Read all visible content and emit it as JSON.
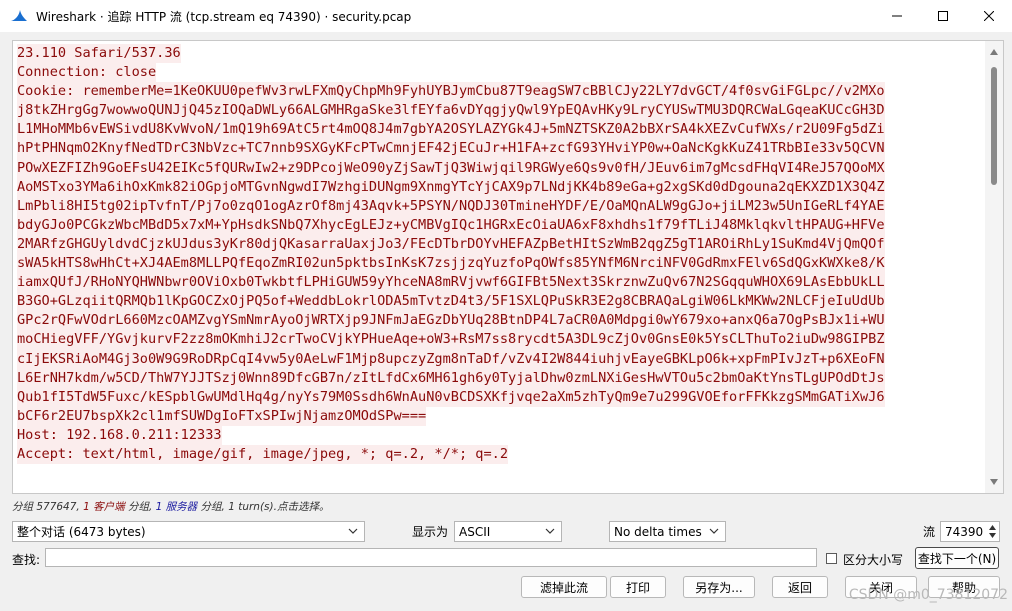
{
  "window": {
    "title": "Wireshark · 追踪 HTTP 流 (tcp.stream eq 74390) · security.pcap",
    "minimize_glyph": "—",
    "close_glyph": "✕"
  },
  "stream_lines": [
    "23.110 Safari/537.36",
    "Connection: close",
    "Cookie: rememberMe=1KeOKUU0pefWv3rwLFXmQyChpMh9FyhUYBJymCbu87T9eagSW7cBBlCJy22LY7dvGCT/4f0svGiFGLpc//v2MXo",
    "j8tkZHrgGg7wowwoQUNJjQ45zIOQaDWLy66ALGMHRgaSke3lfEYfa6vDYqgjyQwl9YpEQAvHKy9LryCYUSwTMU3DQRCWaLGqeaKUCcGH3D",
    "L1MHoMMb6vEWSivdU8KvWvoN/1mQ19h69AtC5rt4mOQ8J4m7gbYA2OSYLAZYGk4J+5mNZTSKZ0A2bBXrSA4kXEZvCufWXs/r2U09Fg5dZi",
    "hPtPHNqmO2KnyfNedTDrC3NbVzc+TC7nnb9SXGyKFcPTwCmnjEF42jECuJr+H1FA+zcfG93YHviYP0w+OaNcKgkKuZ41TRbBIe33v5QCVN",
    "POwXEZFIZh9GoEFsU42EIKc5fQURwIw2+z9DPcojWeO90yZjSawTjQ3Wiwjqil9RGWye6Qs9v0fH/JEuv6im7gMcsdFHqVI4ReJ57QOoMX",
    "AoMSTxo3YMa6ihOxKmk82iOGpjoMTGvnNgwdI7WzhgiDUNgm9XnmgYTcYjCAX9p7LNdjKK4b89eGa+g2xgSKd0dDgouna2qEKXZD1X3Q4Z",
    "LmPbli8HI5tg02ipTvfnT/Pj7o0zqO1ogAzrOf8mj43Aqvk+5PSYN/NQDJ30TmineHYDF/E/OaMQnALW9gGJo+jiLM23w5UnIGeRLf4YAE",
    "bdyGJo0PCGkzWbcMBdD5x7xM+YpHsdkSNbQ7XhycEgLEJz+yCMBVgIQc1HGRxEcOiaUA6xF8xhdhs1f79fTLiJ48MklqkvltHPAUG+HFVe",
    "2MARfzGHGUyldvdCjzkUJdus3yKr80djQKasarraUaxjJo3/FEcDTbrDOYvHEFAZpBetHItSzWmB2qgZ5gT1AROiRhLy1SuKmd4VjQmQOf",
    "sWA5kHTS8wHhCt+XJ4AEm8MLLPQfEqoZmRI02un5pktbsInKsK7zsjjzqYuzfoPqOWfs85YNfM6NrciNFV0GdRmxFElv6SdQGxKWXke8/K",
    "iamxQUfJ/RHoNYQHWNbwr0OViOxb0TwkbtfLPHiGUW59yYhceNA8mRVjvwf6GIFBt5Next3SkrznwZuQv67N2SGqquWHOX69LAsEbbUkLL",
    "B3GO+GLzqiitQRMQb1lKpGOCZxOjPQ5of+WeddbLokrlODA5mTvtzD4t3/5F1SXLQPuSkR3E2g8CBRAQaLgiW06LkMKWw2NLCFjeIuUdUb",
    "GPc2rQFwVOdrL660MzcOAMZvgYSmNmrAyoOjWRTXjp9JNFmJaEGzDbYUq28BtnDP4L7aCR0A0Mdpgi0wY679xo+anxQ6a7OgPsBJx1i+WU",
    "moCHiegVFF/YGvjkurvF2zz8mOKmhiJ2crTwoCVjkYPHueAqe+oW3+RsM7ss8rycdt5A3DL9cZjOv0GnsE0k5YsCLThuTo2iuDw98GIPBZ",
    "cIjEKSRiAoM4Gj3o0W9G9RoDRpCqI4vw5y0AeLwF1Mjp8upczyZgm8nTaDf/vZv4I2W844iuhjvEayeGBKLpO6k+xpFmPIvJzT+p6XEoFN",
    "L6ErNH7kdm/w5CD/ThW7YJJTSzj0Wnn89DfcGB7n/zItLfdCx6MH61gh6y0TyjalDhw0zmLNXiGesHwVTOu5c2bmOaKtYnsTLgUPOdDtJs",
    "Qub1fI5TdW5Fuxc/kESpblGwUMdlHq4g/nyYs79M0Ssdh6WnAuN0vBCDSXKfjvqe2aXm5zhTyQm9e7u299GVOEforFFKkzgSMmGATiXwJ6",
    "bCF6r2EU7bspXk2cl1mfSUWDgIoFTxSPIwjNjamzOMOdSPw===",
    "Host: 192.168.0.211:12333",
    "Accept: text/html, image/gif, image/jpeg, *; q=.2, */*; q=.2"
  ],
  "status_bar": {
    "prefix": "分组 577647, ",
    "client_count": "1",
    "client_label": " 客户端",
    "mid": " 分组, ",
    "server_count": "1",
    "server_label": " 服务器",
    "suffix": " 分组, 1 turn(s).点击选择。"
  },
  "controls": {
    "conversation_select": "整个对话 (6473 bytes)",
    "show_as_label": "显示为",
    "show_as_select": "ASCII",
    "delta_select": "No delta times",
    "stream_label": "流",
    "stream_value": "74390",
    "find_label": "查找:",
    "find_placeholder": "",
    "case_sensitive_label": "区分大小写",
    "find_next_button": "查找下一个(N)"
  },
  "buttons": {
    "filter_out": "滤掉此流",
    "print": "打印",
    "save_as": "另存为...",
    "back": "返回",
    "close": "关闭",
    "help": "帮助"
  },
  "watermark": "CSDN @m0_73812072",
  "colors": {
    "client_text": "#8a0a0a",
    "client_bg": "#fbeded",
    "server_text": "#1a1aa0"
  }
}
